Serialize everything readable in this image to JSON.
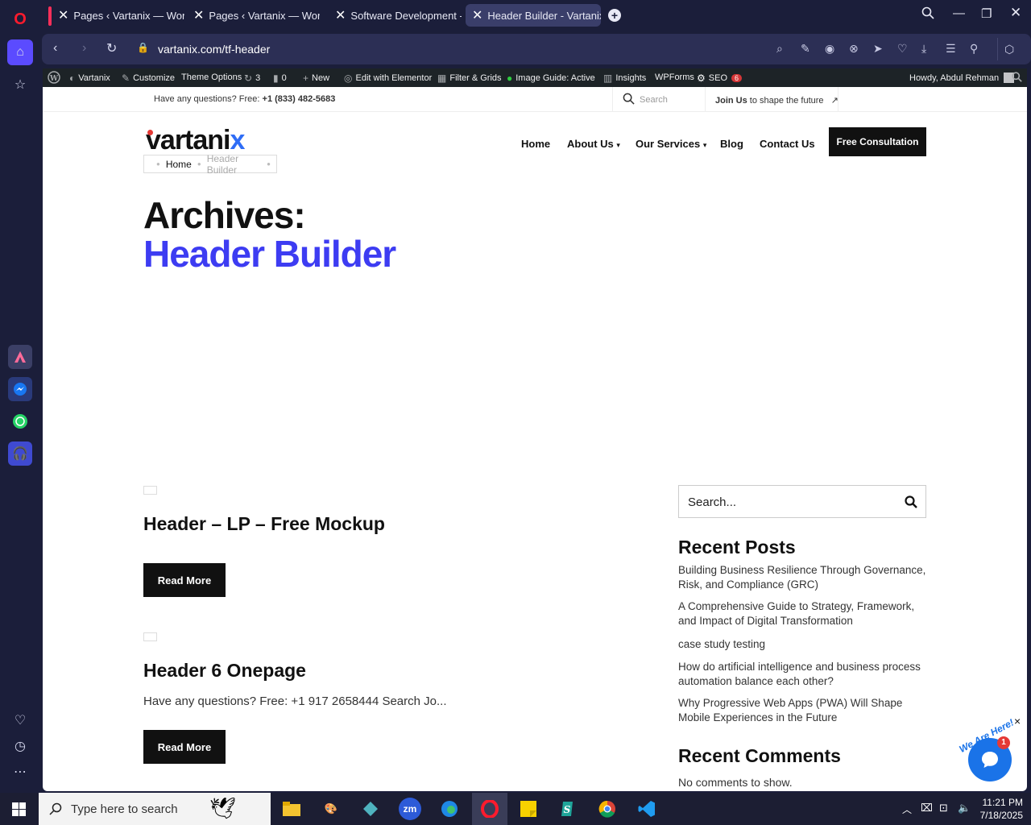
{
  "tabs": [
    {
      "label": "Pages ‹ Vartanix — WordP"
    },
    {
      "label": "Pages ‹ Vartanix — WordP"
    },
    {
      "label": "Software Development - V"
    },
    {
      "label": "Header Builder - Vartanix"
    }
  ],
  "address": {
    "url": "vartanix.com/tf-header"
  },
  "wpbar": {
    "site": "Vartanix",
    "customize": "Customize",
    "theme_options": "Theme Options",
    "updates": "3",
    "comments": "0",
    "new": "New",
    "elementor": "Edit with Elementor",
    "filter": "Filter & Grids",
    "image_guide": "Image Guide: Active",
    "insights": "Insights",
    "wpforms": "WPForms",
    "seo": "SEO",
    "seo_count": "6",
    "howdy": "Howdy, Abdul Rehman"
  },
  "topinfo": {
    "question": "Have any questions? Free:",
    "phone": "+1 (833) 482-5683",
    "search_placeholder": "Search",
    "join": "Join Us",
    "join_rest": "to shape the future",
    "arrow": "↗"
  },
  "header": {
    "logo_main": "vartani",
    "logo_x": "x",
    "menu": [
      "Home",
      "About Us",
      "Our Services",
      "Blog",
      "Contact Us"
    ],
    "cta": "Free Consultation"
  },
  "breadcrumb": {
    "home": "Home",
    "current": "Header Builder"
  },
  "archive": {
    "prefix": "Archives:",
    "title": "Header Builder"
  },
  "posts": [
    {
      "title": "Header – LP – Free Mockup",
      "excerpt": "",
      "button": "Read More"
    },
    {
      "title": "Header 6 Onepage",
      "excerpt": "Have any questions? Free: +1 917 2658444 Search Jo...",
      "button": "Read More"
    }
  ],
  "sidebar_widgets": {
    "search_placeholder": "Search...",
    "recent_posts_title": "Recent Posts",
    "recent_posts": [
      "Building Business Resilience Through Governance, Risk, and Compliance (GRC)",
      "A Comprehensive Guide to Strategy, Framework, and Impact of Digital Transformation",
      "case study testing",
      "How do artificial intelligence and business process automation balance each other?",
      "Why Progressive Web Apps (PWA) Will Shape Mobile Experiences in the Future"
    ],
    "recent_comments_title": "Recent Comments",
    "no_comments": "No comments to show."
  },
  "chat": {
    "badge": "We Are Here!",
    "count": "1",
    "close": "×"
  },
  "taskbar": {
    "search_placeholder": "Type here to search",
    "time": "11:21 PM",
    "date": "7/18/2025"
  },
  "colors": {
    "browser_bg": "#1b1e3a",
    "accent_blue": "#3d3cf2",
    "wp_bar": "#1d2327",
    "button_black": "#111111",
    "chat_blue": "#1a73e8"
  }
}
